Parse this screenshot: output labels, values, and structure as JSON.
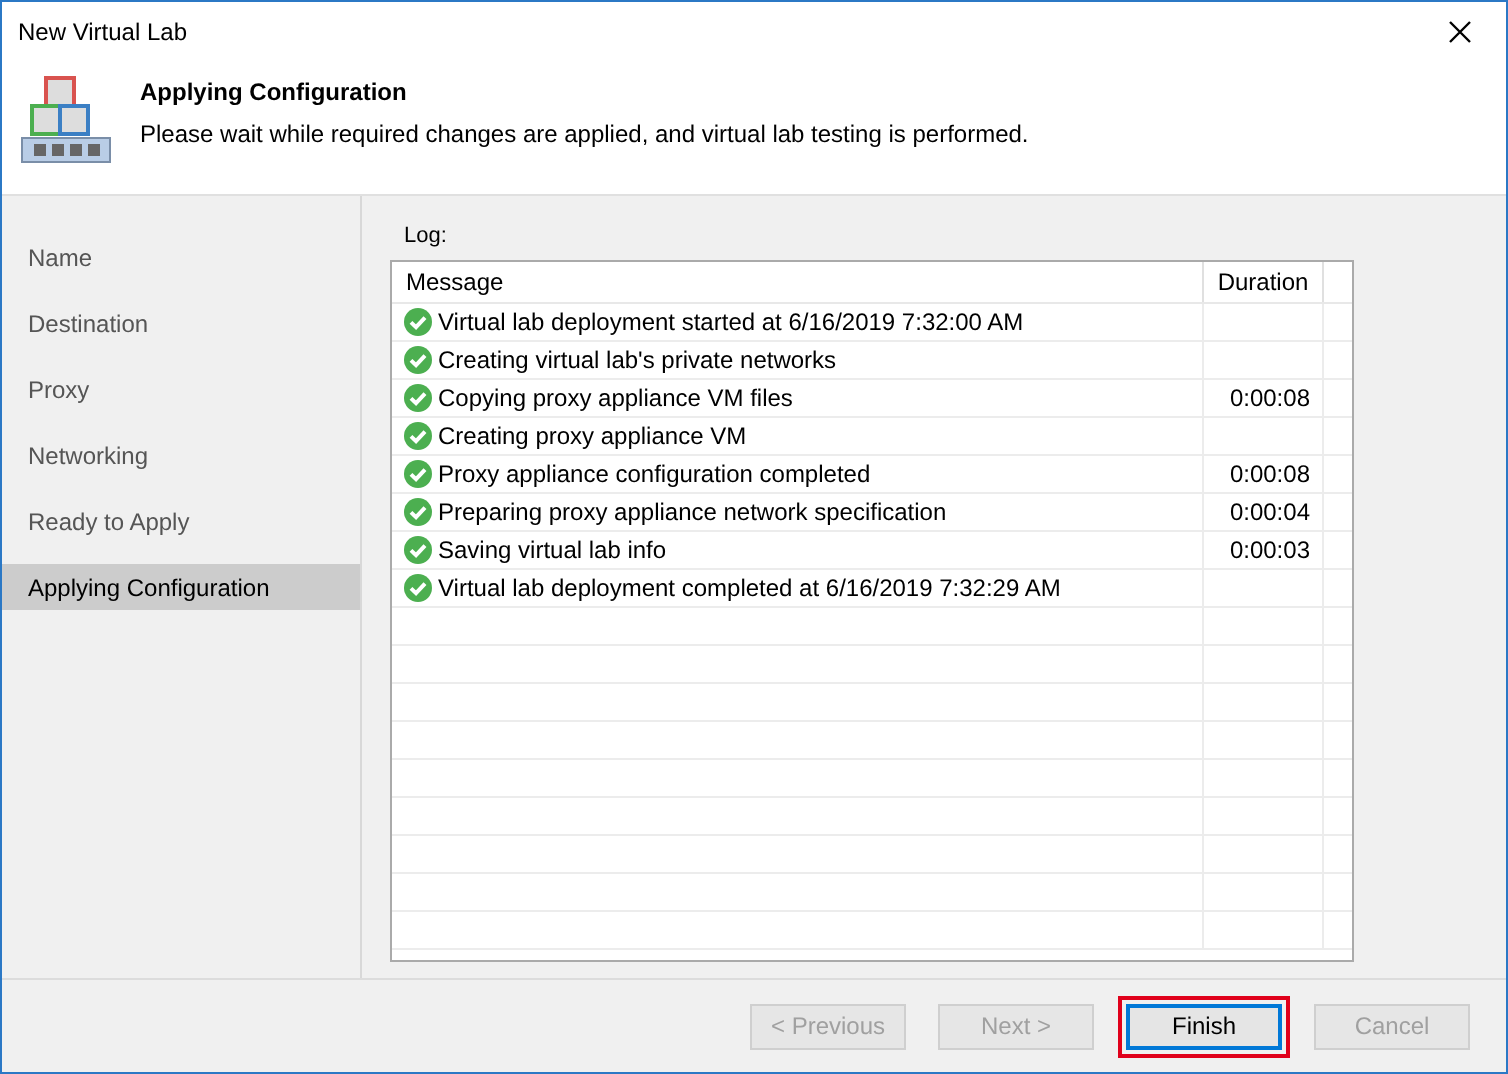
{
  "window": {
    "title": "New Virtual Lab"
  },
  "header": {
    "title": "Applying Configuration",
    "description": "Please wait while required changes are applied, and virtual lab testing is performed."
  },
  "sidebar": {
    "items": [
      {
        "label": "Name",
        "selected": false
      },
      {
        "label": "Destination",
        "selected": false
      },
      {
        "label": "Proxy",
        "selected": false
      },
      {
        "label": "Networking",
        "selected": false
      },
      {
        "label": "Ready to Apply",
        "selected": false
      },
      {
        "label": "Applying Configuration",
        "selected": true
      }
    ]
  },
  "log": {
    "label": "Log:",
    "columns": [
      "Message",
      "Duration"
    ],
    "rows": [
      {
        "succeeded": true,
        "message": "Virtual lab deployment started at 6/16/2019 7:32:00 AM"
      },
      {
        "succeeded": true,
        "message": "Creating virtual lab's private networks"
      },
      {
        "succeeded": true,
        "message": "Copying proxy appliance VM files",
        "duration": "0:00:08"
      },
      {
        "succeeded": true,
        "message": "Creating proxy appliance VM"
      },
      {
        "succeeded": true,
        "message": "Proxy appliance configuration completed",
        "duration": "0:00:08"
      },
      {
        "succeeded": true,
        "message": "Preparing proxy appliance network specification",
        "duration": "0:00:04"
      },
      {
        "succeeded": true,
        "message": "Saving virtual lab info",
        "duration": "0:00:03"
      },
      {
        "succeeded": true,
        "message": "Virtual lab deployment completed at 6/16/2019 7:32:29 AM"
      }
    ]
  },
  "buttons": [
    {
      "label": "< Previous",
      "disabled": true,
      "highlighted": false
    },
    {
      "label": "Next >",
      "disabled": true,
      "highlighted": false
    },
    {
      "label": "Finish",
      "disabled": false,
      "highlighted": true
    },
    {
      "label": "Cancel",
      "disabled": true,
      "highlighted": false
    }
  ]
}
